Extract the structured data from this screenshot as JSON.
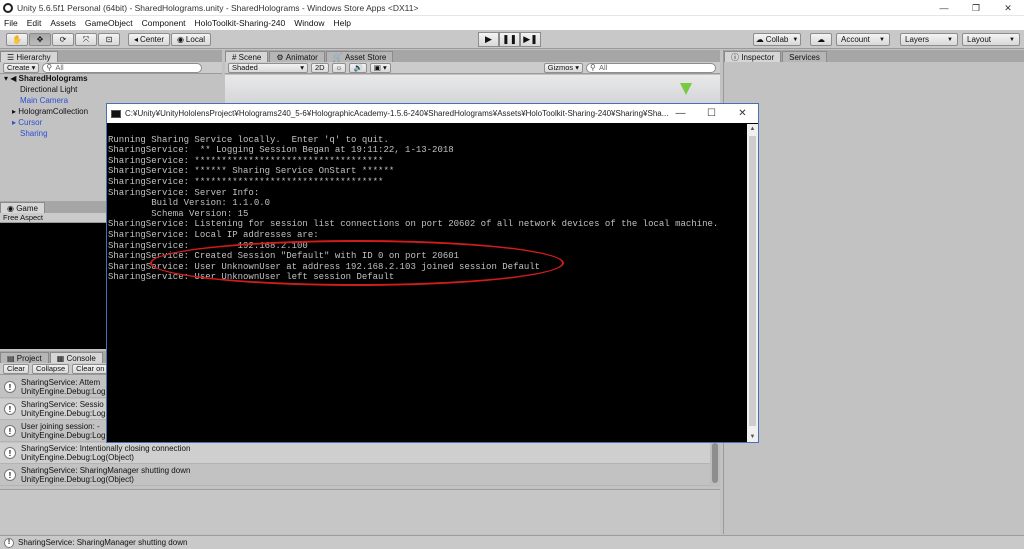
{
  "window": {
    "title": "Unity 5.6.5f1 Personal (64bit) - SharedHolograms.unity - SharedHolograms - Windows Store Apps <DX11>"
  },
  "menu": [
    "File",
    "Edit",
    "Assets",
    "GameObject",
    "Component",
    "HoloToolkit-Sharing-240",
    "Window",
    "Help"
  ],
  "toolbar": {
    "pivot": "Center",
    "space": "Local",
    "collab": "Collab",
    "account": "Account",
    "layers": "Layers",
    "layout": "Layout"
  },
  "hierarchy": {
    "tab": "Hierarchy",
    "create": "Create",
    "search": "All",
    "scene": "SharedHolograms",
    "items": [
      "Directional Light",
      "Main Camera",
      "HologramCollection",
      "Cursor",
      "Sharing"
    ]
  },
  "scene_tabs": [
    "Scene",
    "Animator",
    "Asset Store"
  ],
  "scene_toolbar": {
    "shaded": "Shaded",
    "mode2d": "2D",
    "gizmos": "Gizmos",
    "search": "All"
  },
  "game": {
    "tab": "Game",
    "aspect": "Free Aspect"
  },
  "console": {
    "tabs": [
      "Project",
      "Console"
    ],
    "buttons": [
      "Clear",
      "Collapse",
      "Clear on P"
    ],
    "rows": [
      {
        "l1": "SharingService: Attem",
        "l2": "UnityEngine.Debug:Log"
      },
      {
        "l1": "SharingService: Sessio",
        "l2": "UnityEngine.Debug:Log"
      },
      {
        "l1": "User joining session: -",
        "l2": "UnityEngine.Debug:Log"
      },
      {
        "l1": "SharingService: Intentionally closing connection",
        "l2": "UnityEngine.Debug:Log(Object)"
      },
      {
        "l1": "SharingService: SharingManager shutting down",
        "l2": "UnityEngine.Debug:Log(Object)"
      }
    ]
  },
  "inspector": {
    "tabs": [
      "Inspector",
      "Services"
    ]
  },
  "cmd": {
    "title": "C:¥Unity¥UnityHololensProject¥Holograms240_5-6¥HolographicAcademy-1.5.6-240¥SharedHolograms¥Assets¥HoloToolkit-Sharing-240¥Sharing¥Sha...",
    "lines": [
      "Running Sharing Service locally.  Enter 'q' to quit.",
      "SharingService:  ** Logging Session Began at 19:11:22, 1-13-2018",
      "SharingService: ***********************************",
      "SharingService: ****** Sharing Service OnStart ******",
      "SharingService: ***********************************",
      "SharingService: Server Info:",
      "        Build Version: 1.1.0.0",
      "        Schema Version: 15",
      "SharingService: Listening for session list connections on port 20602 of all network devices of the local machine.",
      "SharingService: Local IP addresses are:",
      "SharingService:         192.168.2.100",
      "SharingService: Created Session \"Default\" with ID 0 on port 20601",
      "SharingService: User UnknownUser at address 192.168.2.103 joined session Default",
      "SharingService: User UnknownUser left session Default"
    ]
  },
  "status": {
    "message": "SharingService: SharingManager shutting down"
  }
}
